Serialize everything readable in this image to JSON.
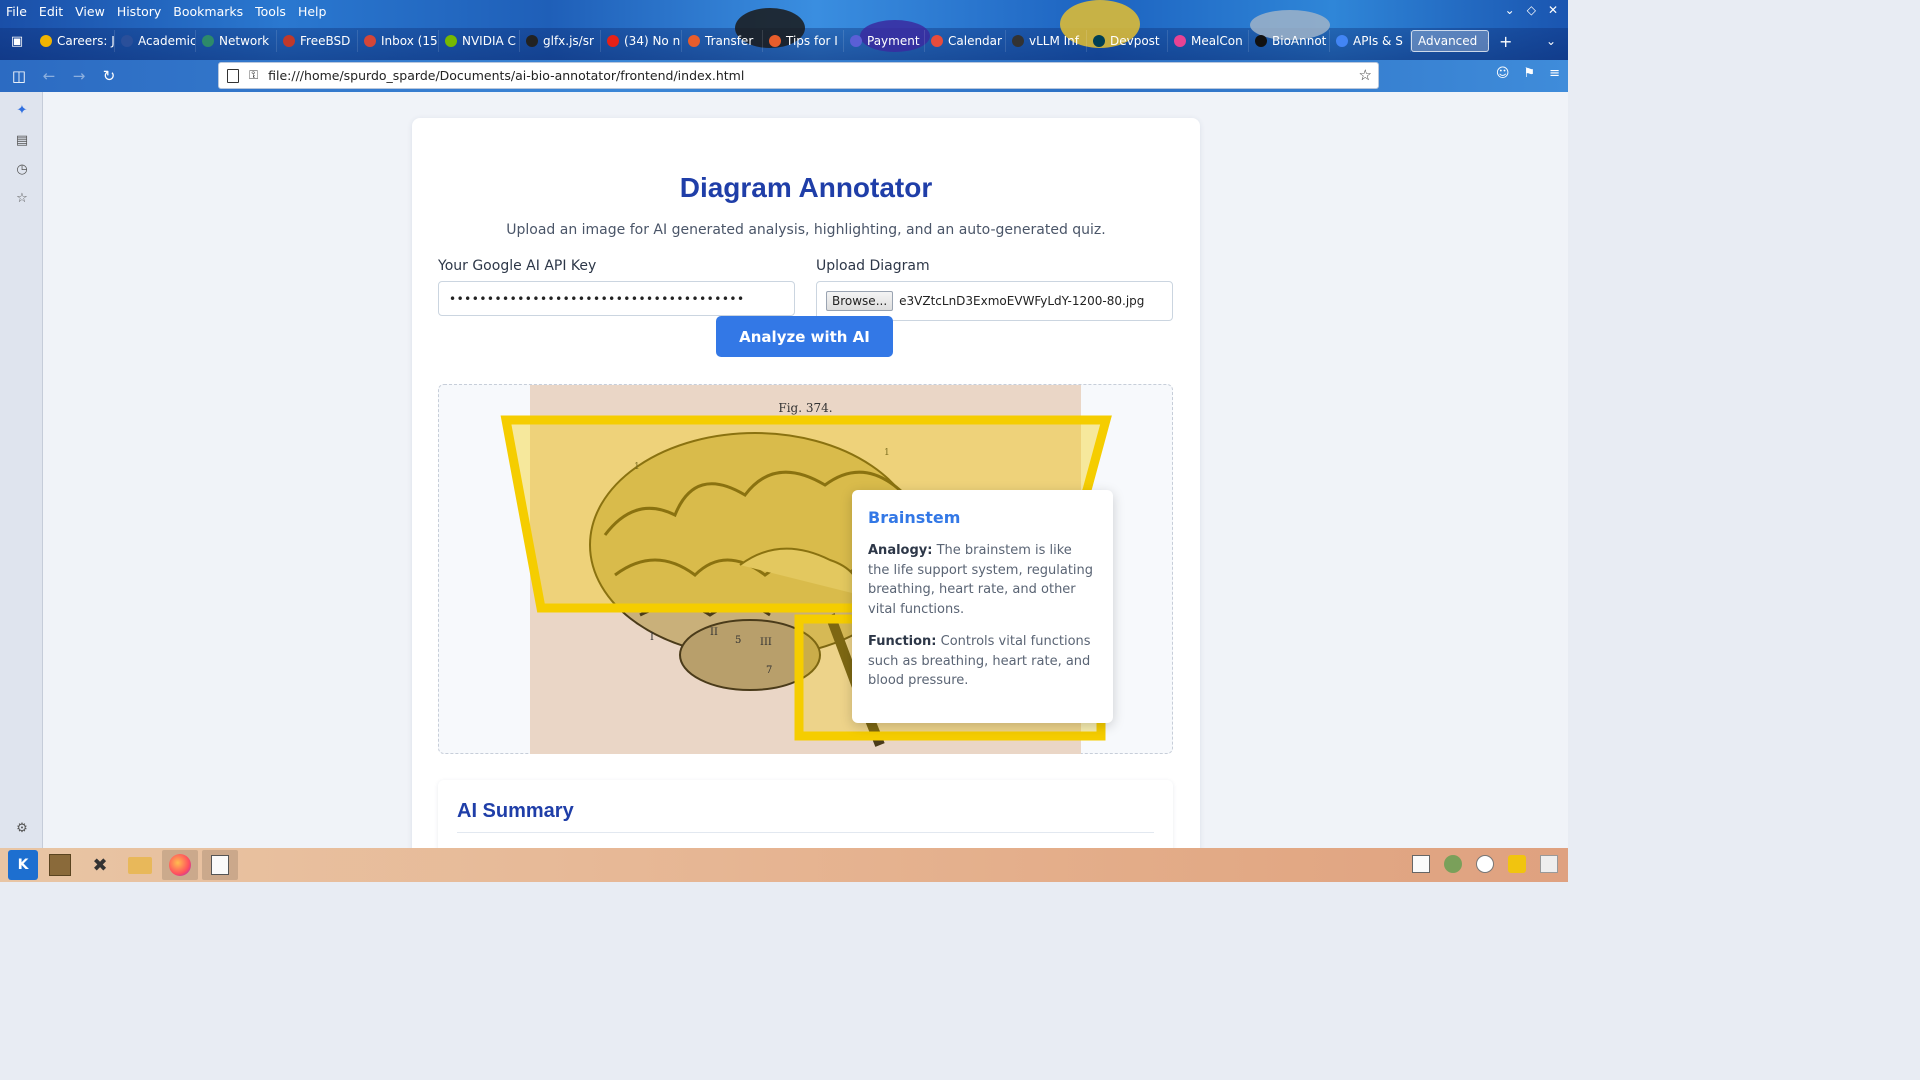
{
  "browser": {
    "menu": [
      "File",
      "Edit",
      "View",
      "History",
      "Bookmarks",
      "Tools",
      "Help"
    ],
    "tabs": [
      {
        "label": "Careers: J",
        "icon_color": "#f0b400"
      },
      {
        "label": "Academic H",
        "icon_color": "#2a4f9a"
      },
      {
        "label": "Network",
        "icon_color": "#2d8a6a"
      },
      {
        "label": "FreeBSD",
        "icon_color": "#c0392b"
      },
      {
        "label": "Inbox (15",
        "icon_color": "#d44638"
      },
      {
        "label": "NVIDIA C",
        "icon_color": "#76b900"
      },
      {
        "label": "glfx.js/sr",
        "icon_color": "#222222"
      },
      {
        "label": "(34) No n",
        "icon_color": "#e62117"
      },
      {
        "label": "Transfer",
        "icon_color": "#e85d2b"
      },
      {
        "label": "Tips for I",
        "icon_color": "#e85d2b"
      },
      {
        "label": "Payment",
        "icon_color": "#5b5fd6"
      },
      {
        "label": "Calendar",
        "icon_color": "#e74c3c"
      },
      {
        "label": "vLLM Inf",
        "icon_color": "#333333"
      },
      {
        "label": "Devpost",
        "icon_color": "#003e54"
      },
      {
        "label": "MealCon",
        "icon_color": "#e84393"
      },
      {
        "label": "BioAnnot",
        "icon_color": "#111111"
      },
      {
        "label": "APIs & S",
        "icon_color": "#4285f4"
      },
      {
        "label": "Advanced",
        "icon_color": "#ffffff",
        "active": true
      }
    ],
    "url": "file:///home/spurdo_sparde/Documents/ai-bio-annotator/frontend/index.html"
  },
  "app": {
    "title": "Diagram Annotator",
    "subtitle": "Upload an image for AI generated analysis, highlighting, and an auto-generated quiz.",
    "api_key_label": "Your Google AI API Key",
    "api_key_value": "•••••••••••••••••••••••••••••••••••••••",
    "upload_label": "Upload Diagram",
    "browse_label": "Browse...",
    "file_name": "e3VZtcLnD3ExmoEVWFyLdY-1200-80.jpg",
    "analyze_label": "Analyze with AI",
    "figure_caption": "Fig. 374.",
    "tooltip": {
      "title": "Brainstem",
      "analogy_label": "Analogy:",
      "analogy_text": "The brainstem is like the life support system, regulating breathing, heart rate, and other vital functions.",
      "function_label": "Function:",
      "function_text": "Controls vital functions such as breathing, heart rate, and blood pressure."
    },
    "summary_title": "AI Summary"
  },
  "colors": {
    "accent": "#3378e6",
    "heading": "#1f3ea8",
    "highlight": "#f5cd00"
  }
}
